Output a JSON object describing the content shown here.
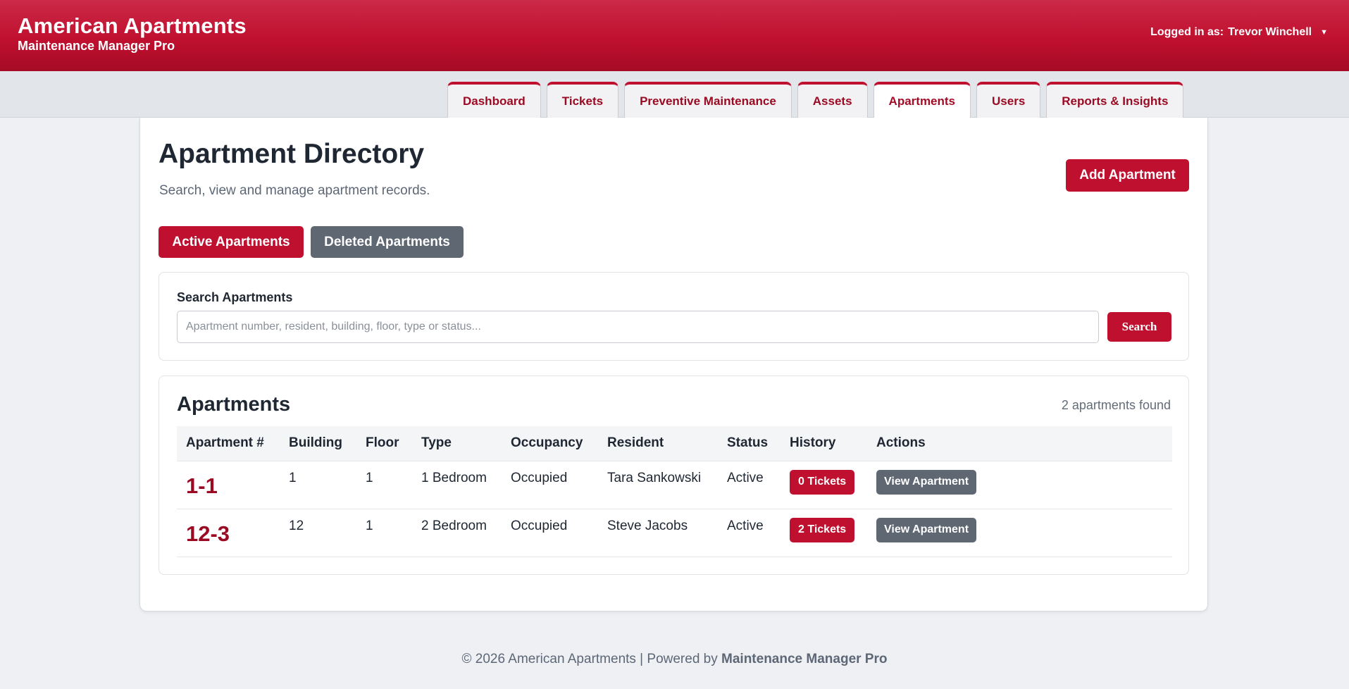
{
  "header": {
    "brand": "American Apartments",
    "subtitle": "Maintenance Manager Pro",
    "user_label": "Logged in as:",
    "user_name": "Trevor Winchell",
    "caret_icon": "caret-down-icon"
  },
  "nav": {
    "tabs": [
      {
        "label": "Dashboard",
        "active": false
      },
      {
        "label": "Tickets",
        "active": false
      },
      {
        "label": "Preventive Maintenance",
        "active": false
      },
      {
        "label": "Assets",
        "active": false
      },
      {
        "label": "Apartments",
        "active": true
      },
      {
        "label": "Users",
        "active": false
      },
      {
        "label": "Reports & Insights",
        "active": false
      }
    ]
  },
  "page": {
    "title": "Apartment Directory",
    "subtitle": "Search, view and manage apartment records.",
    "add_button": "Add Apartment",
    "filter_active": "Active Apartments",
    "filter_deleted": "Deleted Apartments"
  },
  "search": {
    "label": "Search Apartments",
    "placeholder": "Apartment number, resident, building, floor, type or status...",
    "value": "",
    "button": "Search"
  },
  "apartments": {
    "title": "Apartments",
    "count_text": "2 apartments found",
    "columns": [
      "Apartment #",
      "Building",
      "Floor",
      "Type",
      "Occupancy",
      "Resident",
      "Status",
      "History",
      "Actions"
    ],
    "rows": [
      {
        "number": "1-1",
        "building": "1",
        "floor": "1",
        "type": "1 Bedroom",
        "occupancy": "Occupied",
        "resident": "Tara Sankowski",
        "status": "Active",
        "history": "0 Tickets",
        "action": "View Apartment"
      },
      {
        "number": "12-3",
        "building": "12",
        "floor": "1",
        "type": "2 Bedroom",
        "occupancy": "Occupied",
        "resident": "Steve Jacobs",
        "status": "Active",
        "history": "2 Tickets",
        "action": "View Apartment"
      }
    ]
  },
  "footer": {
    "text": "© 2026 American Apartments | Powered by",
    "product": "Maintenance Manager Pro"
  },
  "colors": {
    "brand_red": "#c0102f",
    "dark_red": "#9b0a23",
    "grey_button": "#5f6773"
  }
}
